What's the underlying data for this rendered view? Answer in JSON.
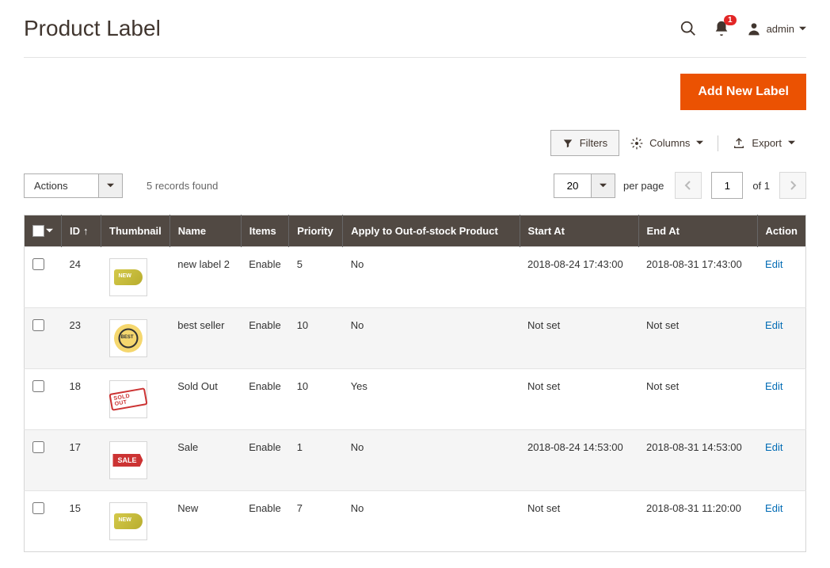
{
  "header": {
    "title": "Product Label",
    "notification_count": "1",
    "username": "admin"
  },
  "primary_action": {
    "label": "Add New Label"
  },
  "toolbar": {
    "filters": "Filters",
    "columns": "Columns",
    "export": "Export"
  },
  "controls": {
    "actions_label": "Actions",
    "records_found": "5 records found",
    "per_page_value": "20",
    "per_page_label": "per page",
    "current_page": "1",
    "of_label": "of 1"
  },
  "table": {
    "headers": {
      "id": "ID",
      "thumbnail": "Thumbnail",
      "name": "Name",
      "items": "Items",
      "priority": "Priority",
      "apply_oos": "Apply to Out-of-stock Product",
      "start_at": "Start At",
      "end_at": "End At",
      "action": "Action"
    },
    "edit_label": "Edit",
    "rows": [
      {
        "id": "24",
        "name": "new label 2",
        "items": "Enable",
        "priority": "5",
        "apply_oos": "No",
        "start_at": "2018-08-24 17:43:00",
        "end_at": "2018-08-31 17:43:00",
        "thumb": "new"
      },
      {
        "id": "23",
        "name": "best seller",
        "items": "Enable",
        "priority": "10",
        "apply_oos": "No",
        "start_at": "Not set",
        "end_at": "Not set",
        "thumb": "best"
      },
      {
        "id": "18",
        "name": "Sold Out",
        "items": "Enable",
        "priority": "10",
        "apply_oos": "Yes",
        "start_at": "Not set",
        "end_at": "Not set",
        "thumb": "sold"
      },
      {
        "id": "17",
        "name": "Sale",
        "items": "Enable",
        "priority": "1",
        "apply_oos": "No",
        "start_at": "2018-08-24 14:53:00",
        "end_at": "2018-08-31 14:53:00",
        "thumb": "sale"
      },
      {
        "id": "15",
        "name": "New",
        "items": "Enable",
        "priority": "7",
        "apply_oos": "No",
        "start_at": "Not set",
        "end_at": "2018-08-31 11:20:00",
        "thumb": "new"
      }
    ]
  }
}
